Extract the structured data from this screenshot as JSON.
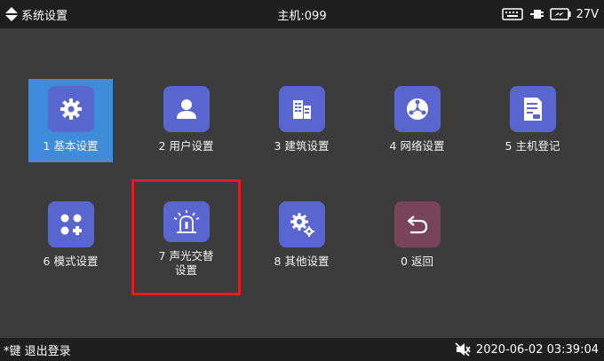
{
  "header": {
    "title": "系统设置",
    "host": "主机:099",
    "voltage": "27V",
    "icons": [
      "up-down-arrow-icon",
      "keyboard-icon",
      "plug-icon",
      "battery-icon"
    ]
  },
  "menu": [
    {
      "label": "1 基本设置",
      "icon": "gear-icon"
    },
    {
      "label": "2 用户设置",
      "icon": "user-icon"
    },
    {
      "label": "3 建筑设置",
      "icon": "building-icon"
    },
    {
      "label": "4 网络设置",
      "icon": "network-icon"
    },
    {
      "label": "5 主机登记",
      "icon": "document-icon"
    },
    {
      "label": "6 模式设置",
      "icon": "mode-icon"
    },
    {
      "label": "7 声光交替设置",
      "line1": "7 声光交替",
      "line2": "设置",
      "icon": "alarm-light-icon"
    },
    {
      "label": "8 其他设置",
      "icon": "gears-icon"
    },
    {
      "label": "0 返回",
      "icon": "return-icon"
    }
  ],
  "footer": {
    "hint": "*键 退出登录",
    "datetime": "2020-06-02 03:39:04",
    "icons": [
      "mute-icon"
    ]
  },
  "colors": {
    "background": "#3c3c3c",
    "bar": "#1f1f1f",
    "tile_selected": "#3d8ddb",
    "icon_bg": "#5a66cf",
    "return_icon_bg": "#7a4458",
    "highlight": "#e11d1d"
  }
}
